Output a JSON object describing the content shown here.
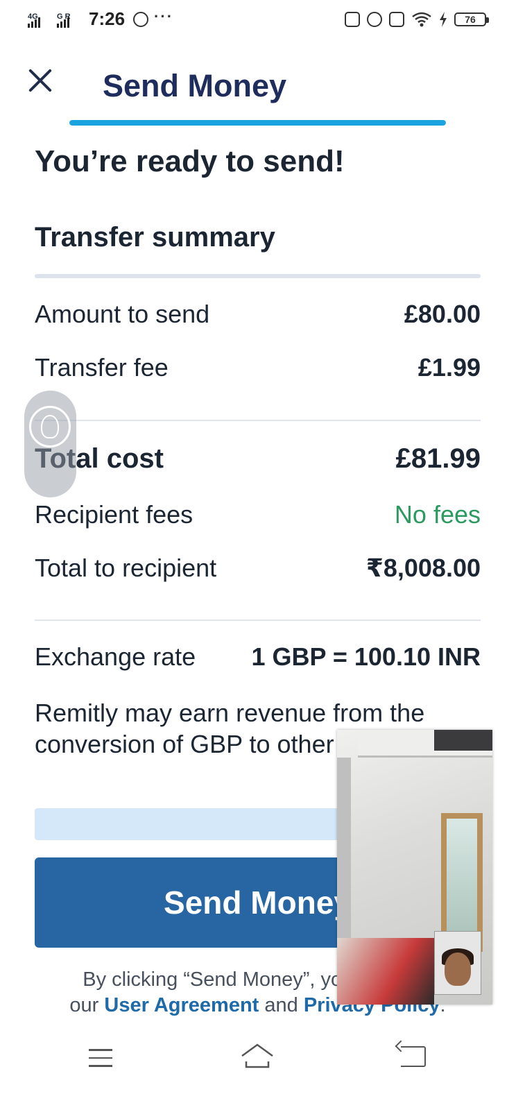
{
  "status_bar": {
    "network_1": "4G",
    "network_2": "G R",
    "time": "7:26",
    "more": "···",
    "battery": "76"
  },
  "header": {
    "title": "Send Money",
    "progress_fraction": 1.0
  },
  "main": {
    "ready_title": "You’re ready to send!",
    "summary_title": "Transfer summary",
    "rows": {
      "amount_to_send": {
        "label": "Amount to send",
        "value": "£80.00"
      },
      "transfer_fee": {
        "label": "Transfer fee",
        "value": "£1.99"
      },
      "total_cost": {
        "label": "Total cost",
        "value": "£81.99"
      },
      "recipient_fees": {
        "label": "Recipient fees",
        "value": "No fees"
      },
      "total_to_recipient": {
        "label": "Total to recipient",
        "value": "₹8,008.00"
      },
      "exchange_rate": {
        "label": "Exchange rate",
        "value": "1 GBP = 100.10 INR"
      }
    },
    "disclaimer": "Remitly may earn revenue from the conversion of GBP to other currencies.",
    "send_button": "Send Money",
    "legal": {
      "prefix": "By clicking “Send Money”, you agree to",
      "mid_prefix": "our",
      "user_agreement": "User Agreement",
      "and": "and",
      "privacy_policy": "Privacy Policy",
      "suffix": "."
    }
  },
  "colors": {
    "title_navy": "#1f2d5c",
    "progress_blue": "#1aa3de",
    "button_blue": "#2866a3",
    "no_fees_green": "#2b9a5f",
    "link_blue": "#1f6aa8"
  },
  "icons": {
    "close": "close-icon",
    "assistant": "assistant-face-icon",
    "nav_menu": "menu-icon",
    "nav_home": "home-icon",
    "nav_back": "back-icon"
  }
}
